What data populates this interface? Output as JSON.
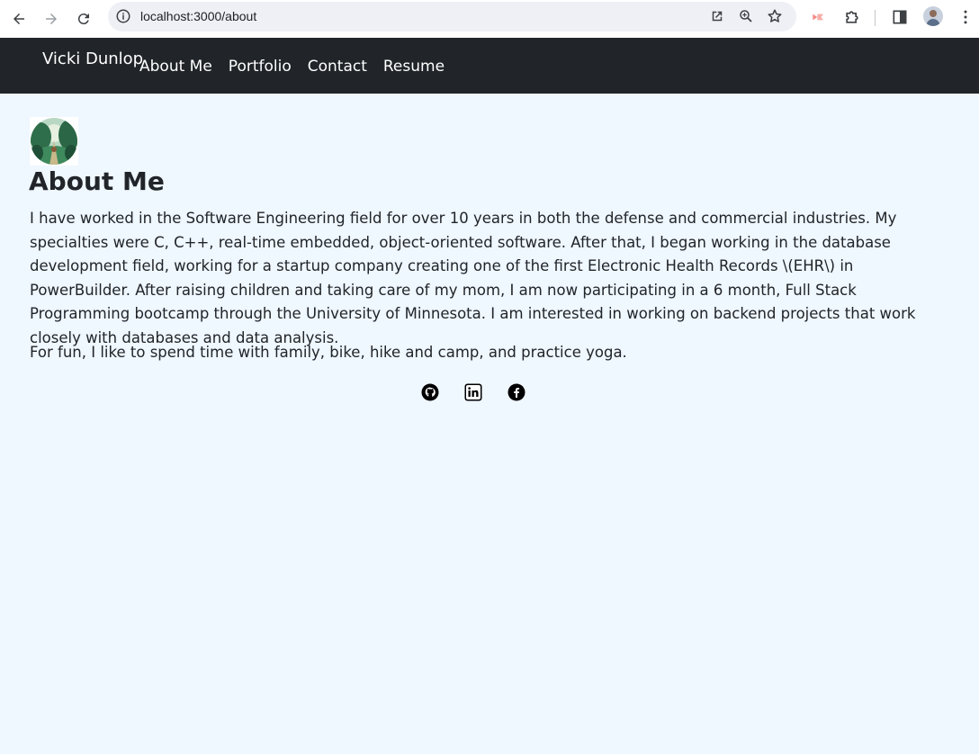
{
  "browser": {
    "url": "localhost:3000/about",
    "icons": [
      "back-icon",
      "forward-icon",
      "reload-icon",
      "site-info-icon",
      "open-in-new-icon",
      "zoom-icon",
      "bookmark-star-icon",
      "extension-icon",
      "puzzle-icon",
      "side-panel-icon",
      "profile-avatar",
      "menu-dots-icon"
    ]
  },
  "nav": {
    "brand": "Vicki Dunlop",
    "links": [
      "About Me",
      "Portfolio",
      "Contact",
      "Resume"
    ]
  },
  "about": {
    "title": "About Me",
    "paragraph1": "I have worked in the Software Engineering field for over 10 years in both the defense and commercial industries. My specialties were C, C++, real-time embedded, object-oriented software. After that, I began working in the database development field, working for a startup company creating one of the first Electronic Health Records \\(EHR\\) in PowerBuilder. After raising children and taking care of my mom, I am now participating in a 6 month, Full Stack Programming bootcamp through the University of Minnesota. I am interested in working on backend projects that work closely with databases and data analysis.",
    "paragraph2": "For fun, I like to spend time with family, bike, hike and camp, and practice yoga."
  },
  "socials": [
    "github-icon",
    "linkedin-icon",
    "facebook-icon"
  ],
  "colors": {
    "navbar": "#212529",
    "page_bg": "#eff7ff",
    "text": "#212529"
  }
}
